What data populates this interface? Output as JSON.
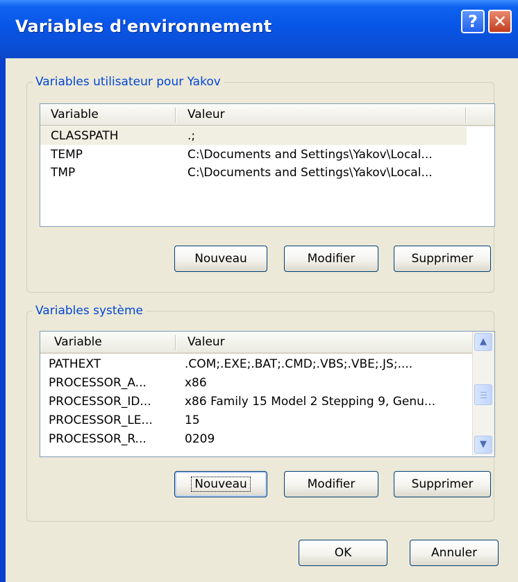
{
  "window": {
    "title": "Variables d'environnement",
    "help_label": "?",
    "close_label": "✕"
  },
  "user_vars": {
    "legend": "Variables utilisateur pour Yakov",
    "columns": [
      "Variable",
      "Valeur"
    ],
    "rows": [
      {
        "variable": "CLASSPATH",
        "value": ".;",
        "selected": true
      },
      {
        "variable": "TEMP",
        "value": "C:\\Documents and Settings\\Yakov\\Local..."
      },
      {
        "variable": "TMP",
        "value": "C:\\Documents and Settings\\Yakov\\Local..."
      }
    ],
    "buttons": {
      "new": "Nouveau",
      "edit": "Modifier",
      "delete": "Supprimer"
    }
  },
  "system_vars": {
    "legend": "Variables système",
    "columns": [
      "Variable",
      "Valeur"
    ],
    "rows": [
      {
        "variable": "PATHEXT",
        "value": ".COM;.EXE;.BAT;.CMD;.VBS;.VBE;.JS;...."
      },
      {
        "variable": "PROCESSOR_A...",
        "value": "x86"
      },
      {
        "variable": "PROCESSOR_ID...",
        "value": "x86 Family 15 Model 2 Stepping 9, Genu..."
      },
      {
        "variable": "PROCESSOR_LE...",
        "value": "15"
      },
      {
        "variable": "PROCESSOR_R...",
        "value": "0209"
      }
    ],
    "buttons": {
      "new": "Nouveau",
      "edit": "Modifier",
      "delete": "Supprimer"
    },
    "scrollbar": {
      "up_icon": "▲",
      "down_icon": "▼"
    }
  },
  "footer": {
    "ok": "OK",
    "cancel": "Annuler"
  },
  "colors": {
    "titlebar": "#0a4fd8",
    "face": "#ece9d8",
    "legend_text": "#0046d5",
    "list_border": "#7f9db9"
  }
}
